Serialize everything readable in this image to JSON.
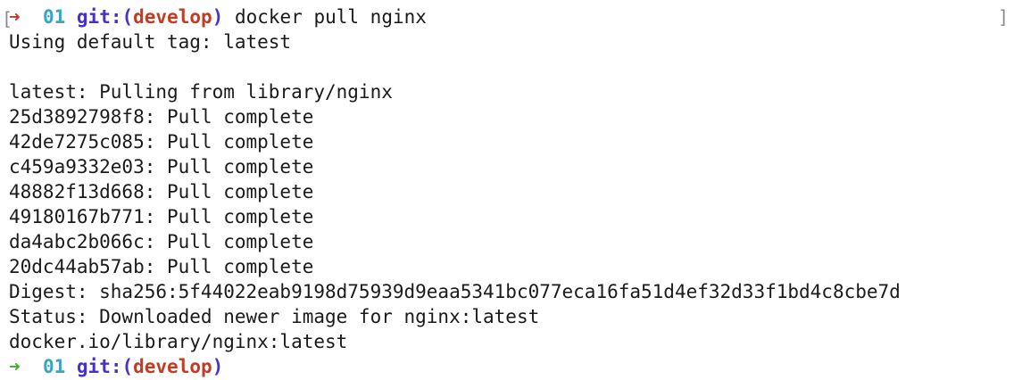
{
  "prompt1": {
    "arrow": "➜",
    "dir": "01",
    "git_label": "git:(",
    "branch": "develop",
    "git_close": ")",
    "command": "docker pull nginx"
  },
  "output": [
    "Using default tag: latest",
    "",
    "latest: Pulling from library/nginx",
    "25d3892798f8: Pull complete",
    "42de7275c085: Pull complete",
    "c459a9332e03: Pull complete",
    "48882f13d668: Pull complete",
    "49180167b771: Pull complete",
    "da4abc2b066c: Pull complete",
    "20dc44ab57ab: Pull complete",
    "Digest: sha256:5f44022eab9198d75939d9eaa5341bc077eca16fa51d4ef32d33f1bd4c8cbe7d",
    "Status: Downloaded newer image for nginx:latest",
    "docker.io/library/nginx:latest"
  ],
  "prompt2": {
    "arrow": "➜",
    "dir": "01",
    "git_label": "git:(",
    "branch": "develop",
    "git_close": ")"
  },
  "colors": {
    "arrow_active": "#c23b22",
    "arrow_idle": "#3fae2e",
    "dir": "#3aa4c4",
    "git": "#4a2fd0",
    "branch": "#c23b22"
  }
}
